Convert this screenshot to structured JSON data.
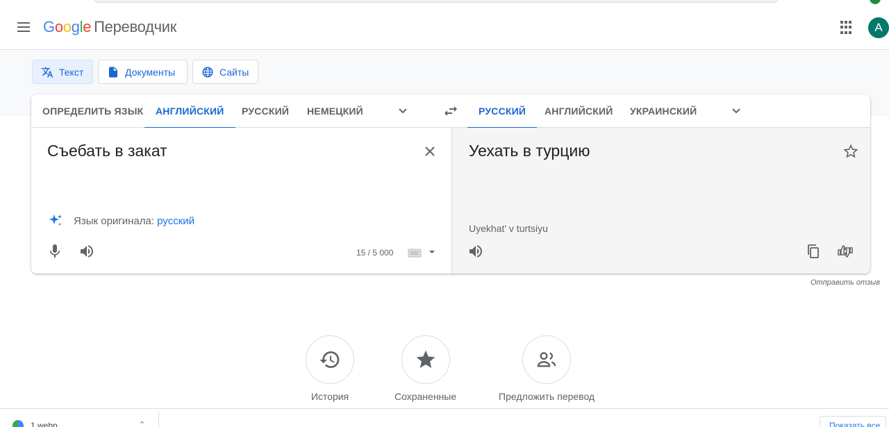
{
  "header": {
    "logo_google": [
      "G",
      "o",
      "o",
      "g",
      "l",
      "e"
    ],
    "product": "Переводчик",
    "avatar_letter": "A"
  },
  "modes": [
    {
      "label": "Текст",
      "icon": "translate-icon",
      "active": true
    },
    {
      "label": "Документы",
      "icon": "document-icon",
      "active": false
    },
    {
      "label": "Сайты",
      "icon": "globe-icon",
      "active": false
    }
  ],
  "source_langs": [
    "ОПРЕДЕЛИТЬ ЯЗЫК",
    "АНГЛИЙСКИЙ",
    "РУССКИЙ",
    "НЕМЕЦКИЙ"
  ],
  "source_active": "АНГЛИЙСКИЙ",
  "target_langs": [
    "РУССКИЙ",
    "АНГЛИЙСКИЙ",
    "УКРАИНСКИЙ"
  ],
  "target_active": "РУССКИЙ",
  "source": {
    "text": "Съебать в закат",
    "detected_prefix": "Язык оригинала:",
    "detected_lang": "русский",
    "char_count": "15 / 5 000"
  },
  "target": {
    "text": "Уехать в турцию",
    "transliteration": "Uyekhat' v turtsiyu"
  },
  "feedback": "Отправить отзыв",
  "actions": [
    {
      "label": "История",
      "icon": "history-icon"
    },
    {
      "label": "Сохраненные",
      "icon": "star-filled-icon"
    },
    {
      "label": "Предложить перевод",
      "icon": "community-icon"
    }
  ],
  "download_bar": {
    "file_name": "1.webp",
    "show_all": "Показать все"
  },
  "colors": {
    "accent": "#1967d2",
    "avatar": "#00796b",
    "target_bg": "#f5f5f5"
  }
}
